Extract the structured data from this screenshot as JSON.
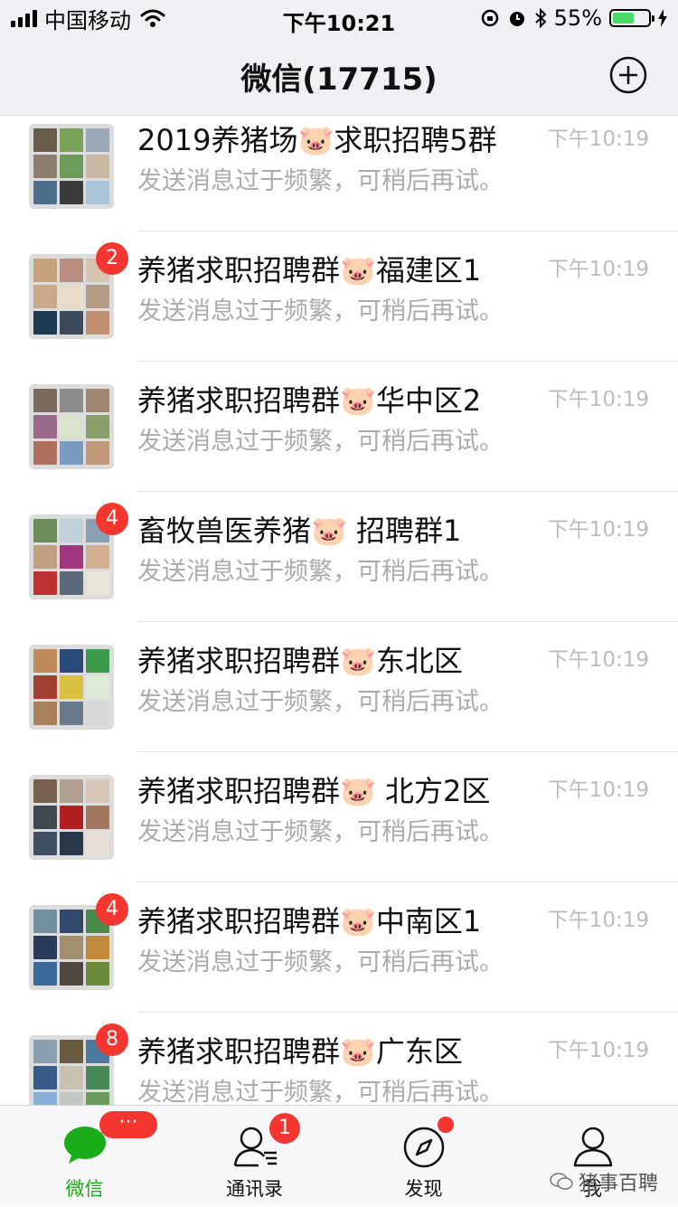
{
  "status": {
    "carrier": "中国移动",
    "time": "下午10:21",
    "battery": "55%"
  },
  "nav": {
    "title": "微信(17715)"
  },
  "chats": [
    {
      "name": "2019养猪场🐷求职招聘5群",
      "msg": "发送消息过于频繁，可稍后再试。",
      "time": "下午10:19",
      "badge": ""
    },
    {
      "name": "养猪求职招聘群🐷福建区1",
      "msg": "发送消息过于频繁，可稍后再试。",
      "time": "下午10:19",
      "badge": "2"
    },
    {
      "name": "养猪求职招聘群🐷华中区2",
      "msg": "发送消息过于频繁，可稍后再试。",
      "time": "下午10:19",
      "badge": ""
    },
    {
      "name": "畜牧兽医养猪🐷 招聘群1",
      "msg": "发送消息过于频繁，可稍后再试。",
      "time": "下午10:19",
      "badge": "4"
    },
    {
      "name": "养猪求职招聘群🐷东北区",
      "msg": "发送消息过于频繁，可稍后再试。",
      "time": "下午10:19",
      "badge": ""
    },
    {
      "name": "养猪求职招聘群🐷 北方2区",
      "msg": "发送消息过于频繁，可稍后再试。",
      "time": "下午10:19",
      "badge": ""
    },
    {
      "name": "养猪求职招聘群🐷中南区1",
      "msg": "发送消息过于频繁，可稍后再试。",
      "time": "下午10:19",
      "badge": "4"
    },
    {
      "name": "养猪求职招聘群🐷广东区",
      "msg": "发送消息过于频繁，可稍后再试。",
      "time": "下午10:19",
      "badge": "8"
    }
  ],
  "tabs": {
    "chats": {
      "label": "微信",
      "badge": "···"
    },
    "contacts": {
      "label": "通讯录",
      "badge": "1"
    },
    "discover": {
      "label": "发现"
    },
    "me": {
      "label": "我"
    }
  },
  "watermark": "猪事百聘",
  "colors": {
    "accent": "#1aad19",
    "badge": "#f43530",
    "nav_bg": "#efeff4"
  }
}
